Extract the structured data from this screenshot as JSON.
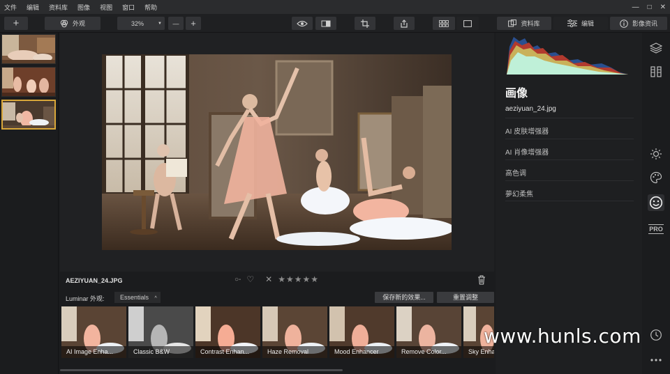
{
  "menu": [
    "文件",
    "编辑",
    "资料库",
    "图像",
    "视图",
    "窗口",
    "帮助"
  ],
  "window_controls": [
    "—",
    "□",
    "✕"
  ],
  "toolbar": {
    "add_label": "+",
    "looks_label": "外观",
    "zoom_value": "32%",
    "zoom_out": "—",
    "zoom_in": "+",
    "library_tab": "资料库",
    "edit_tab": "编辑",
    "info_tab": "影像资讯"
  },
  "filmstrip": {
    "count": 3,
    "selected_index": 2
  },
  "info": {
    "filename": "AEZIYUAN_24.JPG",
    "flag": "○-",
    "heart": "♡",
    "reject": "✕",
    "stars": "★★★★★"
  },
  "looks": {
    "label": "Luminar 外观:",
    "category": "Essentials",
    "save_button": "保存新的效果...",
    "reset_button": "重置调整",
    "items": [
      "AI Image Enha...",
      "Classic B&W",
      "Contrast Enhan...",
      "Haze Removal",
      "Mood Enhancer",
      "Remove Color...",
      "Sky Enha"
    ]
  },
  "panel": {
    "title": "画像",
    "file": "aeziyuan_24.jpg",
    "tools": [
      "AI 皮肤增强器",
      "AI 肖像增强器",
      "高色调",
      "夢幻柔焦"
    ]
  },
  "rail": {
    "pro_label": "PRO"
  },
  "watermark": "www.hunls.com",
  "colors": {
    "accent": "#d9a73a",
    "panel": "#1e1f21",
    "button": "#3a3b3e"
  }
}
